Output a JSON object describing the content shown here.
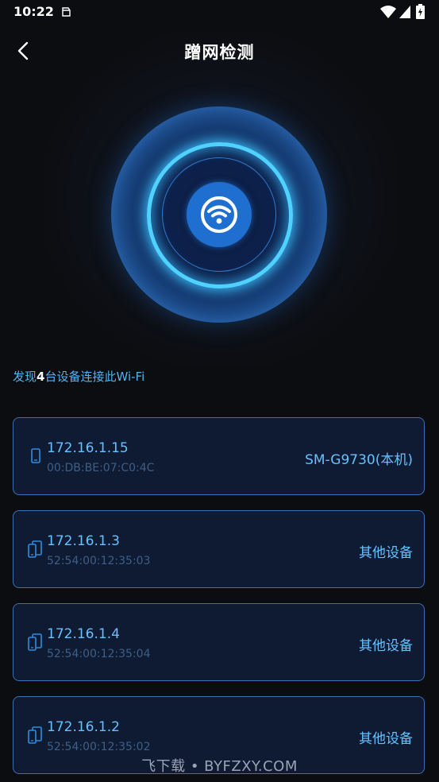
{
  "status_bar": {
    "time": "10:22",
    "icons": [
      "notification-icon",
      "wifi-icon",
      "signal-icon",
      "battery-icon"
    ]
  },
  "header": {
    "title": "蹭网检测",
    "back_icon": "chevron-left-icon"
  },
  "radar": {
    "center_icon": "wifi-icon",
    "accent_color": "#4fd2ff",
    "center_color": "#1f6fd0"
  },
  "summary": {
    "prefix": "发现",
    "count": "4",
    "suffix": "台设备连接此Wi-Fi"
  },
  "devices": [
    {
      "icon": "phone-icon",
      "ip": "172.16.1.15",
      "mac": "00:DB:BE:07:C0:4C",
      "name": "SM-G9730(本机)"
    },
    {
      "icon": "devices-icon",
      "ip": "172.16.1.3",
      "mac": "52:54:00:12:35:03",
      "name": "其他设备"
    },
    {
      "icon": "devices-icon",
      "ip": "172.16.1.4",
      "mac": "52:54:00:12:35:04",
      "name": "其他设备"
    },
    {
      "icon": "devices-icon",
      "ip": "172.16.1.2",
      "mac": "52:54:00:12:35:02",
      "name": "其他设备"
    }
  ],
  "watermark": "飞下载 • BYFZXY.COM",
  "colors": {
    "background": "#0c0d10",
    "card_bg": "#0f1a33",
    "card_border": "#3b6fb3",
    "accent_text": "#66c1ff",
    "mac_text": "#3e5f86"
  }
}
